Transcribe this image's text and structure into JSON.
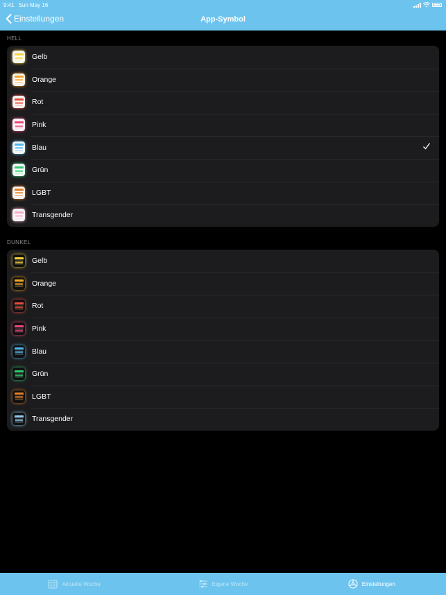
{
  "status_bar": {
    "time": "9:41",
    "date": "Sun May 16"
  },
  "nav": {
    "back_label": "Einstellungen",
    "title": "App-Symbol"
  },
  "sections": [
    {
      "header": "HELL",
      "items": [
        {
          "label": "Gelb",
          "color": "#f7d439",
          "selected": false
        },
        {
          "label": "Orange",
          "color": "#f5a623",
          "selected": false
        },
        {
          "label": "Rot",
          "color": "#e74c3c",
          "selected": false
        },
        {
          "label": "Pink",
          "color": "#e8457a",
          "selected": false
        },
        {
          "label": "Blau",
          "color": "#4fb6ec",
          "selected": true
        },
        {
          "label": "Grün",
          "color": "#2ecc71",
          "selected": false
        },
        {
          "label": "LGBT",
          "color": "#e67e22",
          "selected": false
        },
        {
          "label": "Transgender",
          "color": "#f5a9c9",
          "selected": false
        }
      ]
    },
    {
      "header": "DUNKEL",
      "items": [
        {
          "label": "Gelb",
          "color": "#f7d439",
          "selected": false
        },
        {
          "label": "Orange",
          "color": "#f5a623",
          "selected": false
        },
        {
          "label": "Rot",
          "color": "#e74c3c",
          "selected": false
        },
        {
          "label": "Pink",
          "color": "#e8457a",
          "selected": false
        },
        {
          "label": "Blau",
          "color": "#4fb6ec",
          "selected": false
        },
        {
          "label": "Grün",
          "color": "#2ecc71",
          "selected": false
        },
        {
          "label": "LGBT",
          "color": "#e67e22",
          "selected": false
        },
        {
          "label": "Transgender",
          "color": "#8ecbf0",
          "selected": false
        }
      ]
    }
  ],
  "tabs": [
    {
      "label": "Aktuelle Woche",
      "icon": "calendar-icon",
      "active": false
    },
    {
      "label": "Eigene Woche",
      "icon": "sliders-icon",
      "active": false
    },
    {
      "label": "Einstellungen",
      "icon": "gear-icon",
      "active": true
    }
  ],
  "colors": {
    "accent": "#6cc4ee",
    "group_bg": "#1c1c1e",
    "background": "#000000"
  }
}
